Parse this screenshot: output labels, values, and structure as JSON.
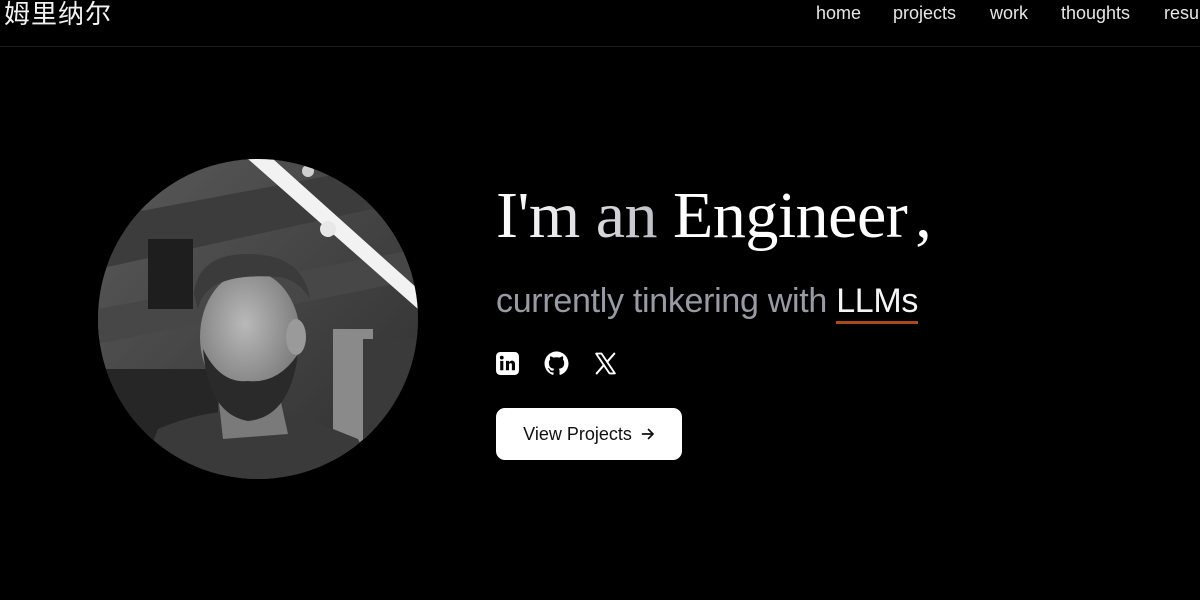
{
  "header": {
    "logo": "姆里纳尔",
    "nav": [
      "home",
      "projects",
      "work",
      "thoughts",
      "resu"
    ]
  },
  "hero": {
    "headline_part1": "I'm an ",
    "headline_part2": "Engineer",
    "headline_comma": ",",
    "subline": "currently tinkering with ",
    "subline_highlight": "LLMs",
    "cta_label": "View Projects",
    "socials": [
      "linkedin-icon",
      "github-icon",
      "x-icon"
    ]
  },
  "colors": {
    "background": "#000000",
    "underline_accent": "#a84a1c",
    "subline_text": "#9a9aa4",
    "button_bg": "#ffffff"
  }
}
